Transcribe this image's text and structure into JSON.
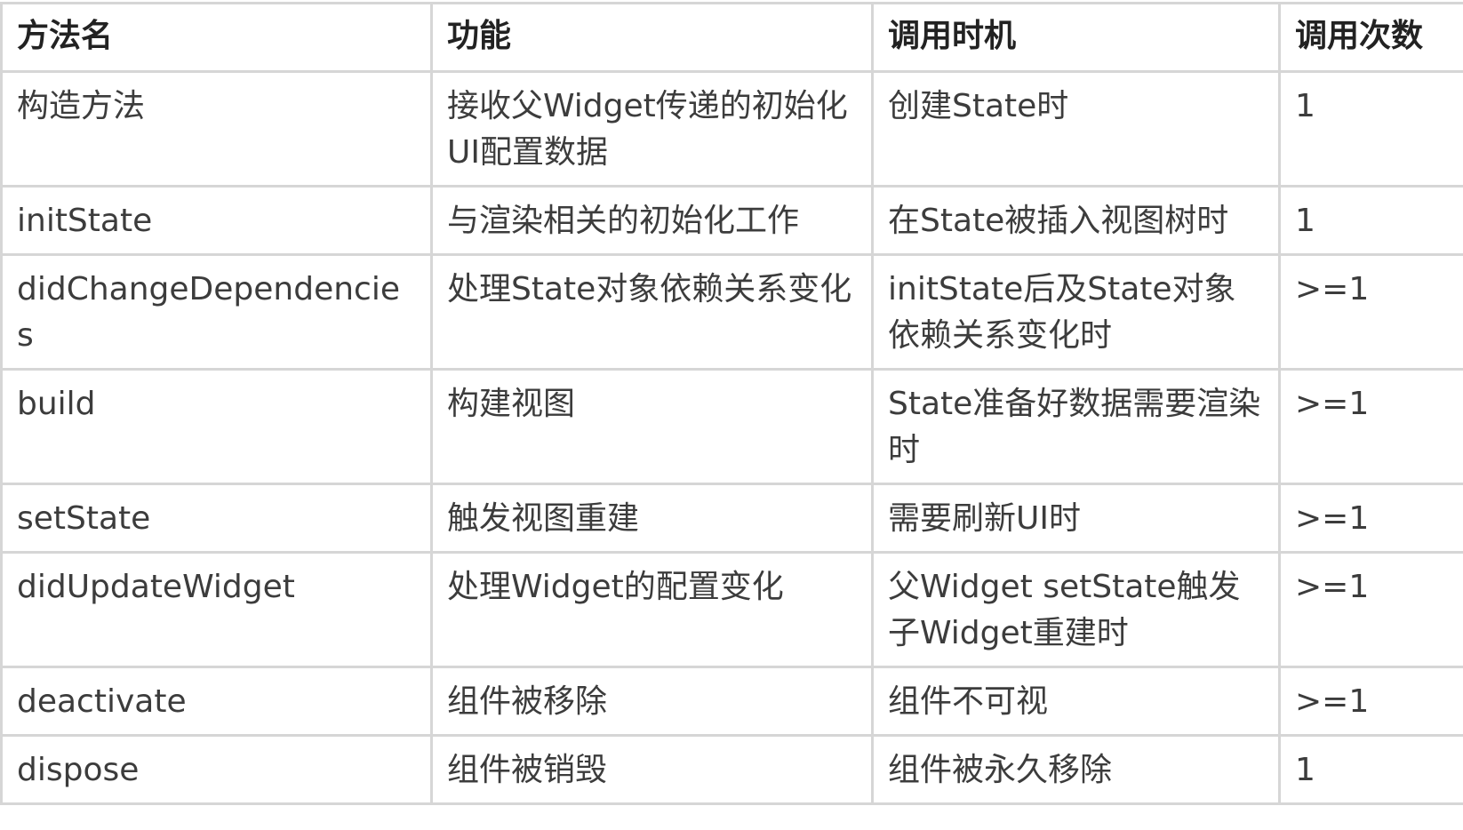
{
  "headers": [
    "方法名",
    "功能",
    "调用时机",
    "调用次数"
  ],
  "rows": [
    [
      "构造方法",
      "接收父Widget传递的初始化UI配置数据",
      "创建State时",
      "1"
    ],
    [
      "initState",
      "与渲染相关的初始化工作",
      "在State被插入视图树时",
      "1"
    ],
    [
      "didChangeDependencies",
      "处理State对象依赖关系变化",
      "initState后及State对象依赖关系变化时",
      ">=1"
    ],
    [
      "build",
      "构建视图",
      "State准备好数据需要渲染时",
      ">=1"
    ],
    [
      "setState",
      "触发视图重建",
      "需要刷新UI时",
      ">=1"
    ],
    [
      "didUpdateWidget",
      "处理Widget的配置变化",
      "父Widget setState触发子Widget重建时",
      ">=1"
    ],
    [
      "deactivate",
      "组件被移除",
      "组件不可视",
      ">=1"
    ],
    [
      "dispose",
      "组件被销毁",
      "组件被永久移除",
      "1"
    ]
  ]
}
